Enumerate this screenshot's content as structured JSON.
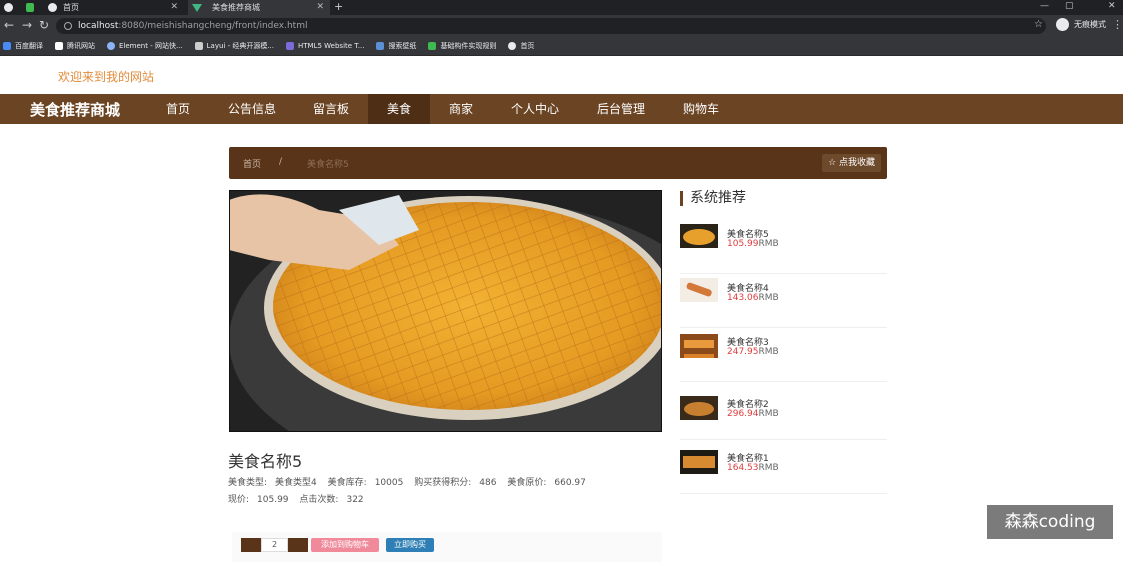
{
  "browser": {
    "tabs": [
      {
        "title": "首页"
      },
      {
        "title": "美食推荐商城"
      }
    ],
    "url_host": "localhost",
    "url_path": ":8080/meishishangcheng/front/index.html",
    "incognito_label": "无痕模式",
    "bookmarks": [
      "百度翻译",
      "腾讯网站",
      "Element - 网站快...",
      "Layui - 经典开源模...",
      "HTML5 Website T...",
      "搜索壁纸",
      "基础构件实现规则",
      "首页"
    ]
  },
  "site": {
    "welcome": "欢迎来到我的网站",
    "brand": "美食推荐商城",
    "nav": [
      "首页",
      "公告信息",
      "留言板",
      "美食",
      "商家",
      "个人中心",
      "后台管理",
      "购物车"
    ]
  },
  "breadcrumb": {
    "home": "首页",
    "sep": "/",
    "current": "美食名称5",
    "fav_button": "☆ 点我收藏"
  },
  "product": {
    "name": "美食名称5",
    "type_label": "美食类型:",
    "type_value": "美食类型4",
    "stock_label": "美食库存:",
    "stock_value": "10005",
    "points_label": "购买获得积分:",
    "points_value": "486",
    "orig_label": "美食原价:",
    "orig_value": "660.97",
    "price_label": "现价:",
    "price_value": "105.99",
    "clicks_label": "点击次数:",
    "clicks_value": "322",
    "qty": "2",
    "add_cart": "添加到购物车",
    "buy_now": "立即购买"
  },
  "recommend": {
    "title": "系统推荐",
    "items": [
      {
        "name": "美食名称5",
        "price": "105.99",
        "unit": "RMB"
      },
      {
        "name": "美食名称4",
        "price": "143.06",
        "unit": "RMB"
      },
      {
        "name": "美食名称3",
        "price": "247.95",
        "unit": "RMB"
      },
      {
        "name": "美食名称2",
        "price": "296.94",
        "unit": "RMB"
      },
      {
        "name": "美食名称1",
        "price": "164.53",
        "unit": "RMB"
      }
    ]
  },
  "watermark": "森森coding",
  "colors": {
    "nav_bg": "#6b4423",
    "accent_price": "#e03c3c",
    "welcome": "#e08b3a"
  }
}
